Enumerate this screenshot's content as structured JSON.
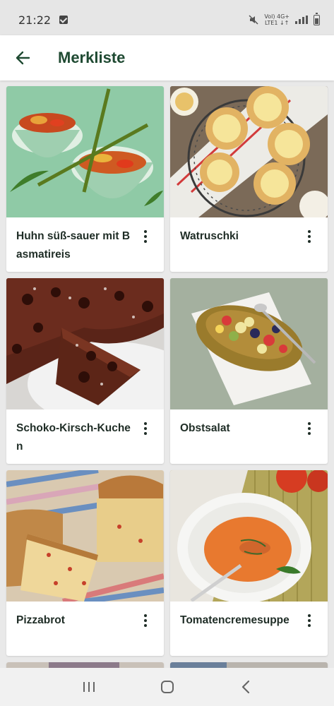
{
  "status_bar": {
    "time": "21:22",
    "network_top": "Vol) 4G+",
    "network_bottom": "LTE1 ↓↑"
  },
  "app_bar": {
    "title": "Merkliste",
    "back_icon": "arrow-left-icon"
  },
  "colors": {
    "title_green": "#1f4a32",
    "card_background": "#ffffff",
    "page_background": "#e9e9e9"
  },
  "recipes": [
    {
      "title": "Huhn süß-sauer mit Basmatireis",
      "image": "chicken-sweet-sour-bowls"
    },
    {
      "title": "Watruschki",
      "image": "watruschki-pastries-on-rack"
    },
    {
      "title": "Schoko-Kirsch-Kuchen",
      "image": "chocolate-cherry-cake"
    },
    {
      "title": "Obstsalat",
      "image": "fruit-salad-in-wooden-bowl"
    },
    {
      "title": "Pizzabrot",
      "image": "pizza-bread-loaf"
    },
    {
      "title": "Tomatencremesuppe",
      "image": "tomato-cream-soup"
    }
  ],
  "nav_bar": {
    "recents_icon": "recents-icon",
    "home_icon": "home-icon",
    "back_icon": "back-chevron-icon"
  }
}
